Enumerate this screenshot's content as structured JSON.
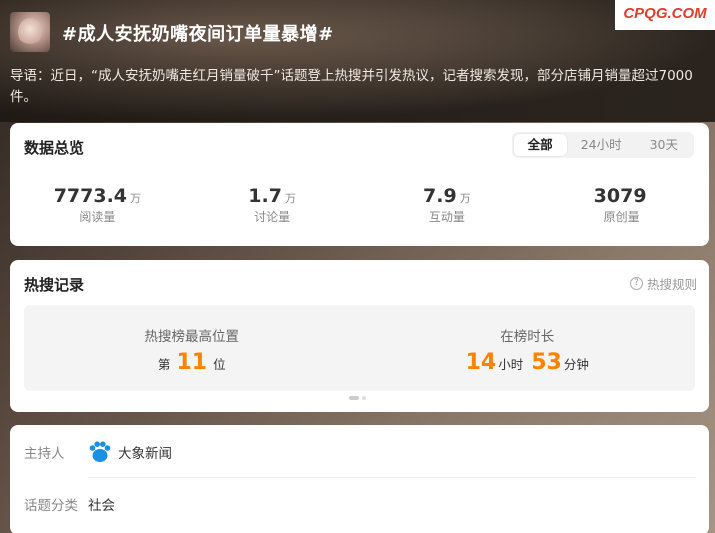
{
  "watermark": "CPQG.COM",
  "topic": {
    "title": "#成人安抚奶嘴夜间订单量暴增#",
    "intro": "导语：近日，“成人安抚奶嘴走红月销量破千”话题登上热搜并引发热议，记者搜索发现，部分店铺月销量超过7000件。"
  },
  "overview": {
    "title": "数据总览",
    "tabs": [
      "全部",
      "24小时",
      "30天"
    ],
    "stats": [
      {
        "value": "7773.4",
        "unit": "万",
        "label": "阅读量"
      },
      {
        "value": "1.7",
        "unit": "万",
        "label": "讨论量"
      },
      {
        "value": "7.9",
        "unit": "万",
        "label": "互动量"
      },
      {
        "value": "3079",
        "unit": "",
        "label": "原创量"
      }
    ]
  },
  "hot": {
    "title": "热搜记录",
    "rules": "热搜规则",
    "rules_icon": "?",
    "peak_caption": "热搜榜最高位置",
    "peak_prefix": "第",
    "peak_value": "11",
    "peak_suffix": "位",
    "duration_caption": "在榜时长",
    "hours": "14",
    "hours_unit": "小时",
    "minutes": "53",
    "minutes_unit": "分钟"
  },
  "info": {
    "host_label": "主持人",
    "host_name": "大象新闻",
    "category_label": "话题分类",
    "category_value": "社会"
  },
  "colors": {
    "accent": "#ff8200",
    "watermark": "#e23b2e"
  }
}
